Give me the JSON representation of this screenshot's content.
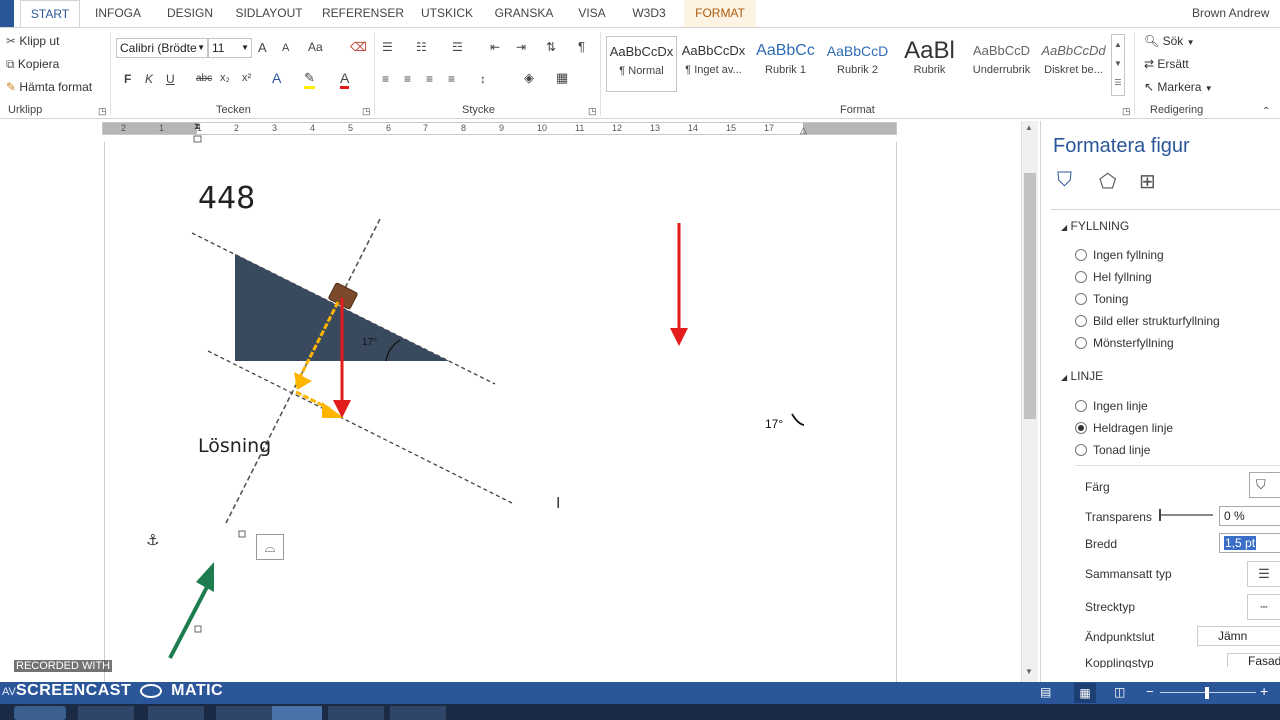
{
  "tabs": [
    {
      "label": "START",
      "active": true
    },
    {
      "label": "INFOGA"
    },
    {
      "label": "DESIGN"
    },
    {
      "label": "SIDLAYOUT"
    },
    {
      "label": "REFERENSER"
    },
    {
      "label": "UTSKICK"
    },
    {
      "label": "GRANSKA"
    },
    {
      "label": "VISA"
    },
    {
      "label": "W3D3"
    },
    {
      "label": "FORMAT",
      "contextual": true
    }
  ],
  "user": "Brown Andrew",
  "clipboard": {
    "cut": "Klipp ut",
    "copy": "Kopiera",
    "format_painter": "Hämta format",
    "group_label": "Urklipp"
  },
  "font": {
    "family": "Calibri (Brödte",
    "size": "11",
    "grow": "A",
    "shrink": "A",
    "case": "Aa",
    "bold": "F",
    "italic": "K",
    "underline": "U",
    "strike": "abc",
    "subscript": "x₂",
    "superscript": "x²",
    "group_label": "Tecken"
  },
  "paragraph": {
    "group_label": "Stycke",
    "show_marks": "¶"
  },
  "styles": {
    "group_label": "Format",
    "items": [
      {
        "preview": "AaBbCcDx",
        "name": "¶ Normal"
      },
      {
        "preview": "AaBbCcDx",
        "name": "¶ Inget av..."
      },
      {
        "preview": "AaBbCc",
        "name": "Rubrik 1"
      },
      {
        "preview": "AaBbCcD",
        "name": "Rubrik 2"
      },
      {
        "preview": "AaBl",
        "name": "Rubrik"
      },
      {
        "preview": "AaBbCcD",
        "name": "Underrubrik"
      },
      {
        "preview": "AaBbCcDd",
        "name": "Diskret be..."
      }
    ]
  },
  "editing": {
    "find": "Sök",
    "replace": "Ersätt",
    "select": "Markera",
    "group_label": "Redigering"
  },
  "ruler_numbers": [
    "2",
    "1",
    "1",
    "2",
    "3",
    "4",
    "5",
    "6",
    "7",
    "8",
    "9",
    "10",
    "11",
    "12",
    "13",
    "14",
    "15",
    "17"
  ],
  "document": {
    "number": "448",
    "solution_label": "Lösning",
    "angle_small": "17°",
    "angle_label": "17°"
  },
  "pane": {
    "title": "Formatera figur",
    "fill_header": "FYLLNING",
    "fill_options": [
      "Ingen fyllning",
      "Hel fyllning",
      "Toning",
      "Bild eller strukturfyllning",
      "Mönsterfyllning"
    ],
    "line_header": "LINJE",
    "line_options": [
      {
        "label": "Ingen linje",
        "selected": false
      },
      {
        "label": "Heldragen linje",
        "selected": true
      },
      {
        "label": "Tonad linje",
        "selected": false
      }
    ],
    "color_label": "Färg",
    "transparency_label": "Transparens",
    "transparency_value": "0 %",
    "width_label": "Bredd",
    "width_value": "1,5 pt",
    "compound_label": "Sammansatt typ",
    "dash_label": "Strecktyp",
    "cap_label": "Ändpunktslut",
    "cap_value": "Jämn",
    "join_label": "Kopplingstyp",
    "join_value": "Fasad"
  },
  "watermark": {
    "line1": "RECORDED WITH",
    "line2": "SCREENCAST",
    "line3": "MATIC"
  },
  "status_left": "AV",
  "colors": {
    "accent": "#2b579a",
    "triangle": "#3a4a5e",
    "red_arrow": "#e21b1b",
    "green_arrow": "#1e7d4f",
    "orange_arrow": "#ffb400",
    "block": "#7a4a2a"
  }
}
